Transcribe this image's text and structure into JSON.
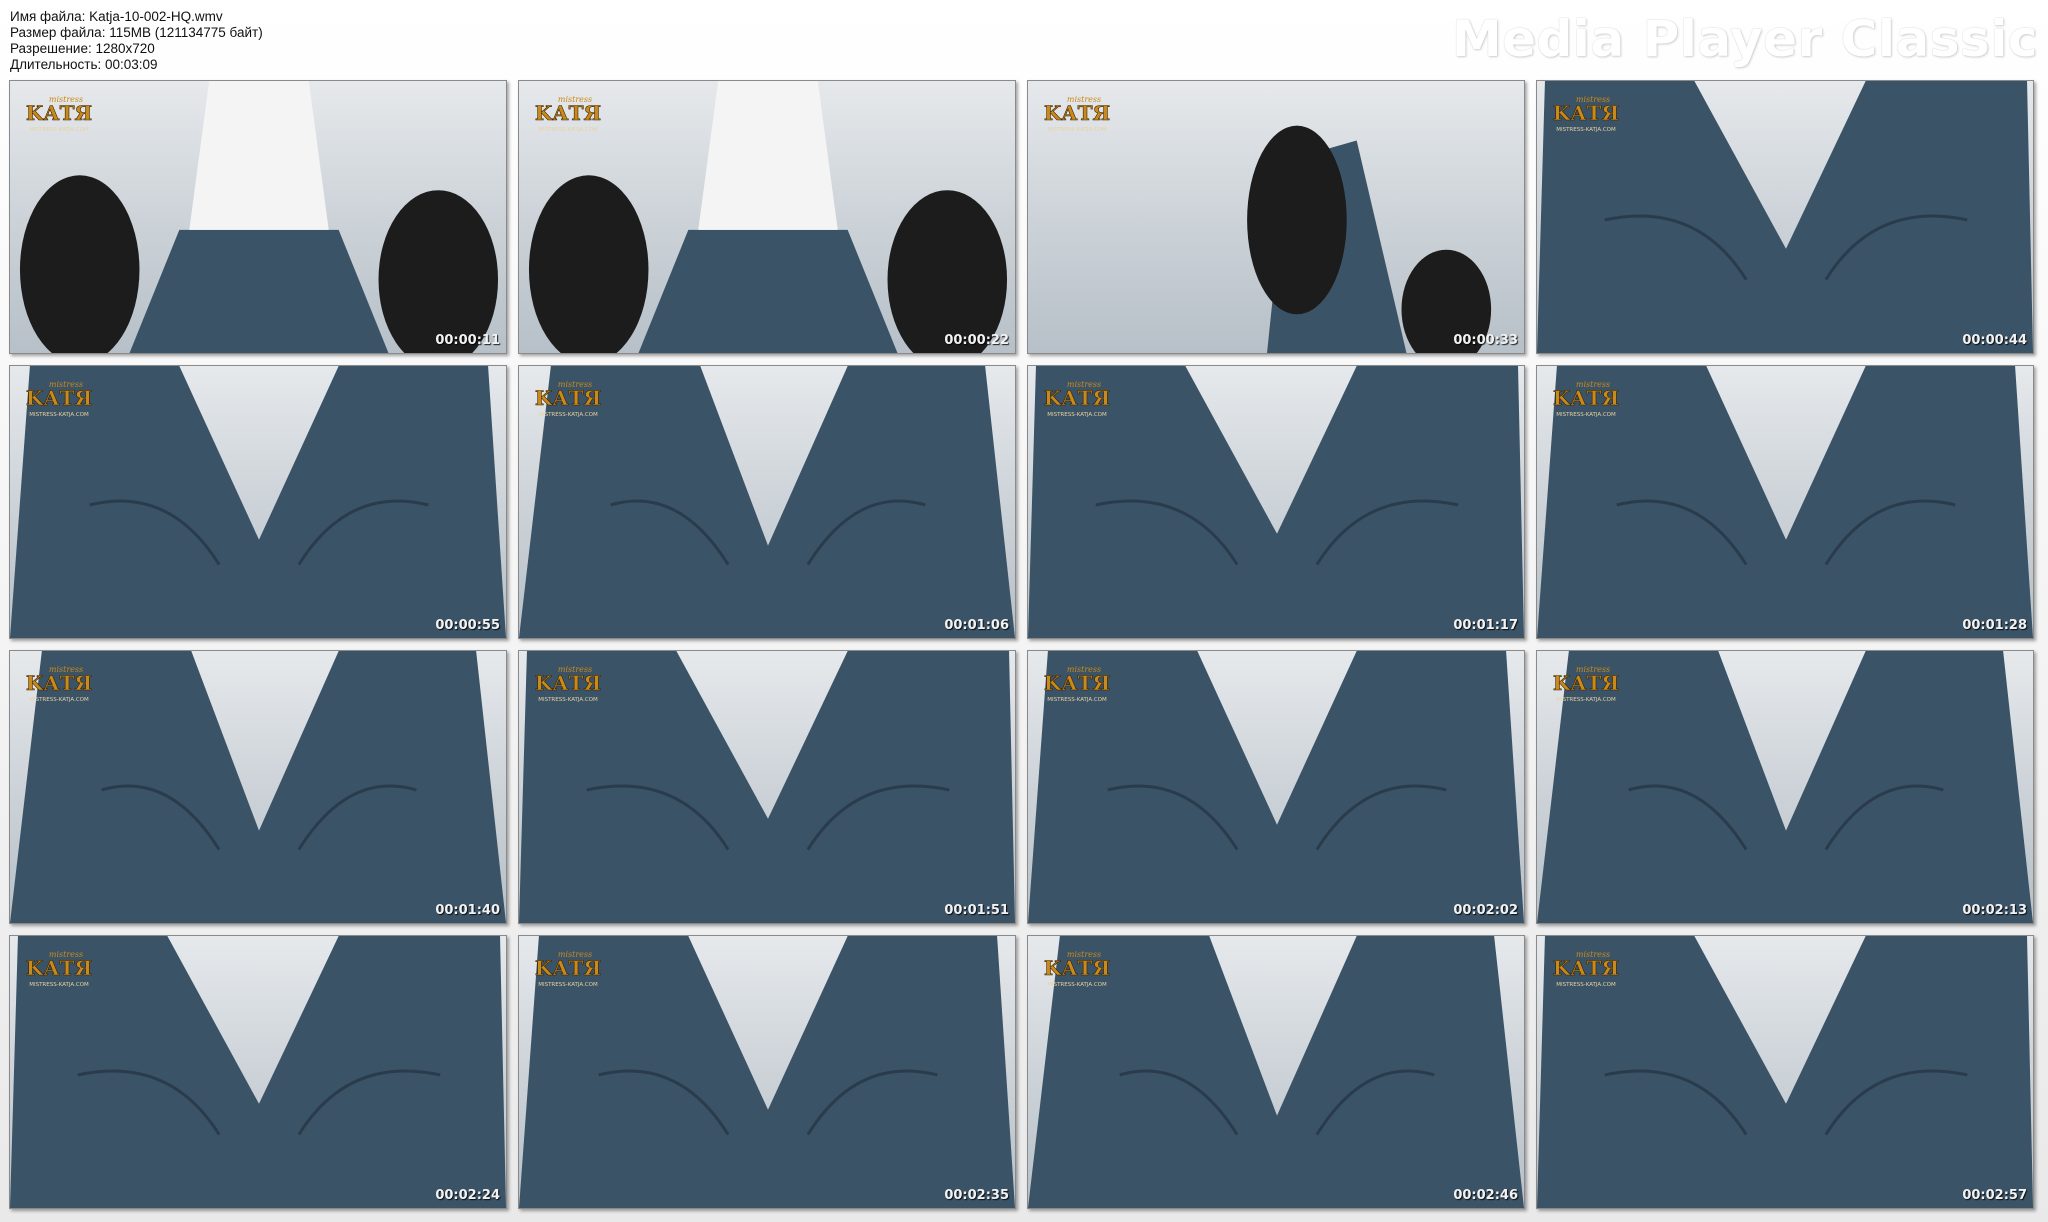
{
  "file_info": {
    "name_line": "Имя файла: Katja-10-002-HQ.wmv",
    "size_line": "Размер файла: 115MB (121134775 байт)",
    "resolution_line": "Разрешение: 1280x720",
    "duration_line": "Длительность: 00:03:09"
  },
  "brand": "Media Player Classic",
  "watermark": {
    "script_text": "mistress",
    "main_text": "KАТЯ",
    "url_text": "MISTRESS-KATJA.COM"
  },
  "colors": {
    "denim": "#3a5367",
    "boot": "#1c1c1c",
    "logo_gold": "#c98a1b"
  },
  "thumbnails": [
    {
      "time": "00:00:11",
      "scene": "boots-from-below"
    },
    {
      "time": "00:00:22",
      "scene": "boots-from-below"
    },
    {
      "time": "00:00:33",
      "scene": "boot-sole"
    },
    {
      "time": "00:00:44",
      "scene": "jeans-legs"
    },
    {
      "time": "00:00:55",
      "scene": "jeans-legs"
    },
    {
      "time": "00:01:06",
      "scene": "jeans-legs"
    },
    {
      "time": "00:01:17",
      "scene": "jeans-legs"
    },
    {
      "time": "00:01:28",
      "scene": "jeans-legs"
    },
    {
      "time": "00:01:40",
      "scene": "jeans-legs"
    },
    {
      "time": "00:01:51",
      "scene": "jeans-legs"
    },
    {
      "time": "00:02:02",
      "scene": "jeans-legs"
    },
    {
      "time": "00:02:13",
      "scene": "jeans-legs"
    },
    {
      "time": "00:02:24",
      "scene": "jeans-legs"
    },
    {
      "time": "00:02:35",
      "scene": "jeans-legs"
    },
    {
      "time": "00:02:46",
      "scene": "jeans-legs"
    },
    {
      "time": "00:02:57",
      "scene": "jeans-legs"
    }
  ]
}
